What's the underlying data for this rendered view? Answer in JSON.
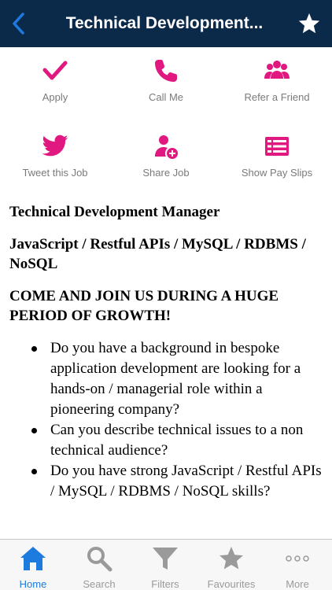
{
  "nav": {
    "title": "Technical Development...",
    "back_icon": "chevron-left-icon",
    "favourite_icon": "star-icon",
    "accent": "#1d7be0",
    "bg": "#0b2a4a"
  },
  "actions": [
    {
      "label": "Apply",
      "icon": "checkmark-icon"
    },
    {
      "label": "Call Me",
      "icon": "phone-icon"
    },
    {
      "label": "Refer a Friend",
      "icon": "people-icon"
    },
    {
      "label": "Tweet this Job",
      "icon": "twitter-icon"
    },
    {
      "label": "Share Job",
      "icon": "add-user-icon"
    },
    {
      "label": "Show Pay Slips",
      "icon": "list-icon"
    }
  ],
  "action_color": "#e0187f",
  "content": {
    "job_title": "Technical Development Manager",
    "skills": "JavaScript / Restful APIs / MySQL / RDBMS / NoSQL",
    "headline": "COME AND JOIN US DURING A HUGE PERIOD OF GROWTH!",
    "bullets": [
      "Do you have a background in bespoke application development are looking for a hands-on / managerial role within a pioneering company?",
      "Can you describe technical issues to a non technical audience?",
      "Do you have strong JavaScript / Restful APIs / MySQL / RDBMS / NoSQL skills?"
    ]
  },
  "tabs": [
    {
      "label": "Home",
      "icon": "home-icon",
      "active": true
    },
    {
      "label": "Search",
      "icon": "search-icon",
      "active": false
    },
    {
      "label": "Filters",
      "icon": "filter-icon",
      "active": false
    },
    {
      "label": "Favourites",
      "icon": "star-icon",
      "active": false
    },
    {
      "label": "More",
      "icon": "more-icon",
      "active": false
    }
  ]
}
